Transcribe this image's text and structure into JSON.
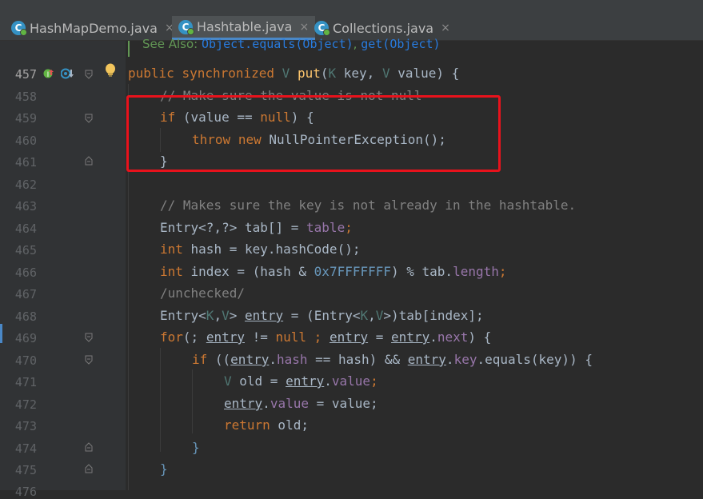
{
  "tabs": [
    {
      "label": "HashMapDemo.java",
      "icon": "class-icon",
      "active": false
    },
    {
      "label": "Hashtable.java",
      "icon": "class-icon",
      "active": true
    },
    {
      "label": "Collections.java",
      "icon": "class-icon",
      "active": false
    }
  ],
  "close_glyph": "×",
  "class_glyph": "C",
  "doc": {
    "prefix": "See Also: ",
    "ref1": "Object.equals(Object)",
    "sep": ", ",
    "ref2": "get(Object)"
  },
  "line_numbers": [
    "457",
    "458",
    "459",
    "460",
    "461",
    "462",
    "463",
    "464",
    "465",
    "466",
    "467",
    "468",
    "469",
    "470",
    "471",
    "472",
    "473",
    "474",
    "475",
    "476"
  ],
  "code": {
    "l457": {
      "a": "public",
      "b": "synchronized",
      "c": "V",
      "d": "put",
      "e": "(",
      "f": "K",
      "g": " key, ",
      "h": "V",
      "i": " value) {"
    },
    "l458": "// Make sure the value is not null",
    "l459": {
      "a": "if",
      "b": " (value == ",
      "c": "null",
      "d": ") {"
    },
    "l460": {
      "a": "throw",
      "b": "new",
      "c": " NullPointerException();"
    },
    "l461": "}",
    "l463": "// Makes sure the key is not already in the hashtable.",
    "l464": {
      "a": "Entry<?,?> tab[] = ",
      "b": "table",
      "c": ";"
    },
    "l465": {
      "a": "int",
      "b": " hash = key.hashCode();"
    },
    "l466": {
      "a": "int",
      "b": " index = (hash & ",
      "c": "0x7FFFFFFF",
      "d": ") % tab.",
      "e": "length",
      "f": ";"
    },
    "l467": "/unchecked/",
    "l468": {
      "a": "Entry<",
      "b": "K",
      "c": ",",
      "d": "V",
      "e": "> ",
      "f": "entry",
      "g": " = (Entry<",
      "h": "K",
      "i": ",",
      "j": "V",
      "k": ">)tab[index];"
    },
    "l469": {
      "a": "for",
      "b": "(; ",
      "c": "entry",
      "d": " != ",
      "e": "null",
      "f": " ; ",
      "g": "entry",
      "h": " = ",
      "i": "entry",
      ".": ".",
      "j": "next",
      ") {": ") {"
    },
    "l470": {
      "a": "if",
      "b": " ((",
      "c": "entry",
      ".": ".",
      "d": "hash",
      "e": " == hash) && ",
      "f": "entry",
      "g": ".",
      "h": "key",
      "i": ".equals(key)) {"
    },
    "l471": {
      "a": "V",
      "b": " old = ",
      "c": "entry",
      "d": ".",
      "e": "value",
      "f": ";"
    },
    "l472": {
      "a": "entry",
      "b": ".",
      "c": "value",
      "d": " = value;"
    },
    "l473": {
      "a": "return",
      "b": " old;"
    },
    "l474": "}",
    "l475": "}"
  },
  "colors": {
    "highlight_box": "#e8121c",
    "keyword": "#cc7832",
    "comment": "#808080",
    "method": "#ffc66d",
    "field": "#9876aa",
    "number": "#6897bb"
  }
}
